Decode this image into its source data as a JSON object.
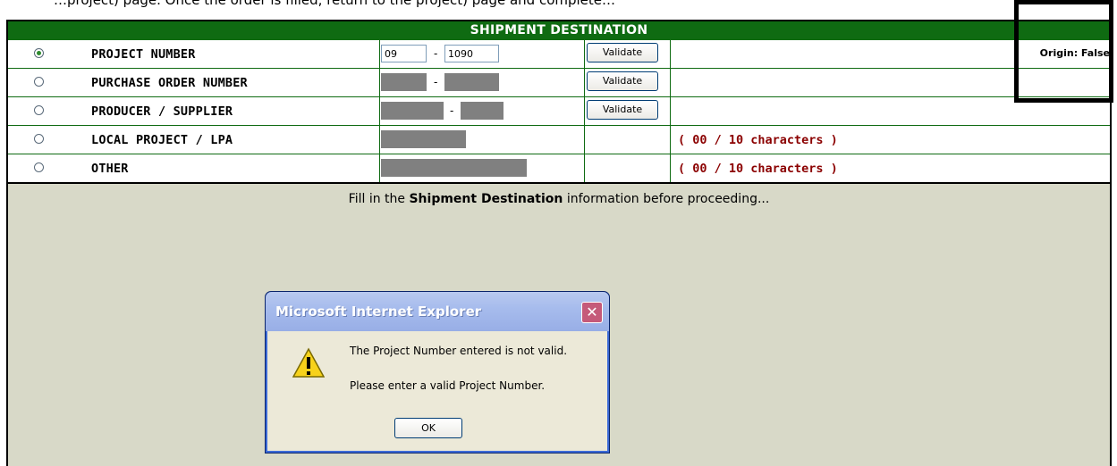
{
  "top_text": "…project) page. Once the order is filled, return to the project) page and complete…",
  "table": {
    "header": "SHIPMENT DESTINATION",
    "rows": [
      {
        "label": "PROJECT NUMBER",
        "selected": true,
        "input_a": "09",
        "input_b": "1090",
        "button": "Validate",
        "extra": "Origin: False"
      },
      {
        "label": "PURCHASE ORDER NUMBER",
        "selected": false,
        "button": "Validate"
      },
      {
        "label": "PRODUCER / SUPPLIER",
        "selected": false,
        "button": "Validate"
      },
      {
        "label": "LOCAL PROJECT / LPA",
        "selected": false,
        "chars": "( 00 / 10 characters )"
      },
      {
        "label": "OTHER",
        "selected": false,
        "chars": "( 00 / 10 characters )"
      }
    ]
  },
  "instruction": {
    "before": "Fill in the ",
    "bold": "Shipment Destination",
    "after": " information before proceeding..."
  },
  "dialog": {
    "title": "Microsoft Internet Explorer",
    "close": "✕",
    "message1": "The Project Number entered is not valid.",
    "message2": "Please enter a valid Project Number.",
    "ok": "OK",
    "icon": "warning-icon"
  },
  "colors": {
    "header_bg": "#0f6b12",
    "chars_text": "#8b0000",
    "panel_bg": "#d8d9c8"
  }
}
